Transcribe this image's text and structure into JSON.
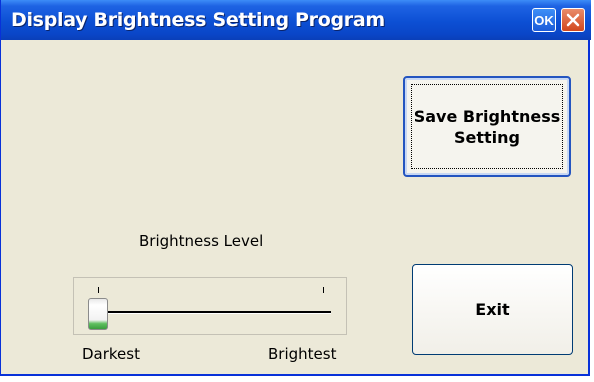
{
  "window": {
    "title": "Display Brightness Setting Program",
    "ok_label": "OK",
    "close_icon": "close-icon"
  },
  "buttons": {
    "save_label_line1": "Save Brightness",
    "save_label_line2": "Setting",
    "exit_label": "Exit"
  },
  "slider": {
    "caption": "Brightness Level",
    "min_label": "Darkest",
    "max_label": "Brightest",
    "value_fraction": 0.0
  },
  "colors": {
    "titlebar": "#0c4fd4",
    "window_bg": "#ece9d8",
    "close_button": "#d2471d",
    "thumb_accent": "#3a9d3d"
  }
}
